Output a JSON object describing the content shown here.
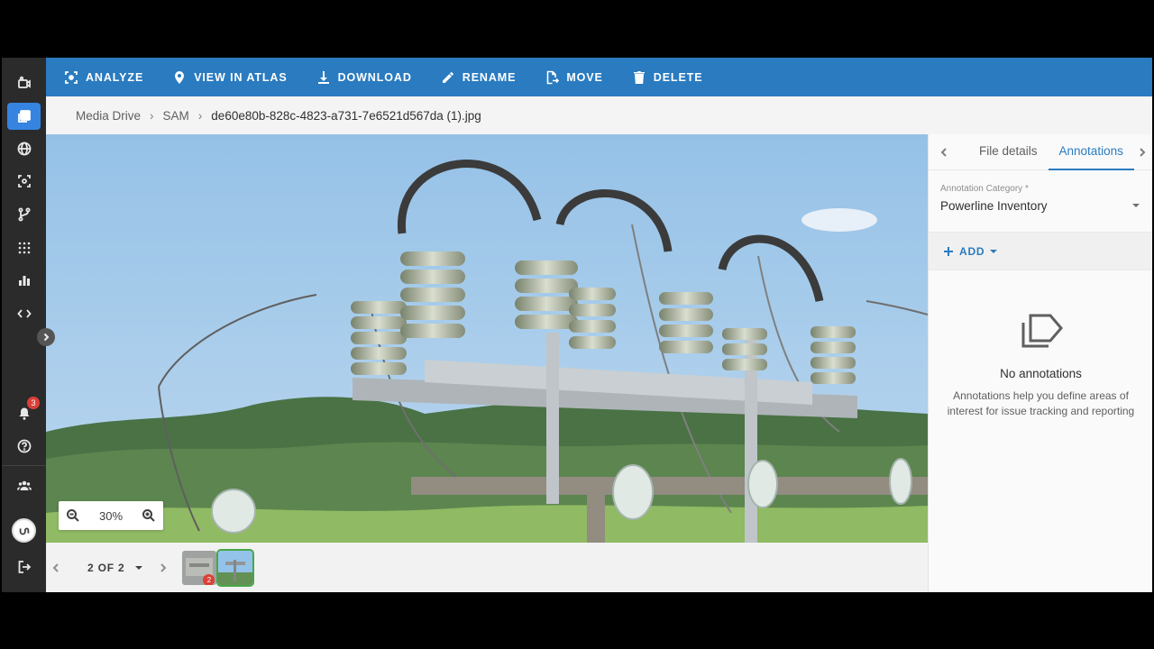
{
  "rail": {
    "items": [
      {
        "icon": "camera-icon"
      },
      {
        "icon": "media-library-icon",
        "active": true
      },
      {
        "icon": "globe-icon"
      },
      {
        "icon": "scan-icon"
      },
      {
        "icon": "workflow-icon"
      },
      {
        "icon": "apps-grid-icon"
      },
      {
        "icon": "bar-chart-icon"
      },
      {
        "icon": "code-icon"
      }
    ],
    "notifications_count": "3"
  },
  "toolbar": {
    "analyze": "ANALYZE",
    "view_in_atlas": "VIEW IN ATLAS",
    "download": "DOWNLOAD",
    "rename": "RENAME",
    "move": "MOVE",
    "delete": "DELETE"
  },
  "breadcrumb": {
    "root": "Media Drive",
    "folder": "SAM",
    "file": "de60e80b-828c-4823-a731-7e6521d567da (1).jpg"
  },
  "viewer": {
    "zoom": "30%"
  },
  "pager": {
    "label": "2 OF 2",
    "thumb_badge": "2"
  },
  "panel": {
    "tabs": [
      "File details",
      "Annotations"
    ],
    "category_label": "Annotation Category *",
    "category_value": "Powerline Inventory",
    "add_label": "ADD",
    "empty_title": "No annotations",
    "empty_desc": "Annotations help you define areas of interest for issue tracking and reporting"
  },
  "colors": {
    "toolbar": "#1d73bd",
    "rail": "#1e1e1e",
    "accent": "#2a7de1",
    "badge": "#d9342b"
  }
}
